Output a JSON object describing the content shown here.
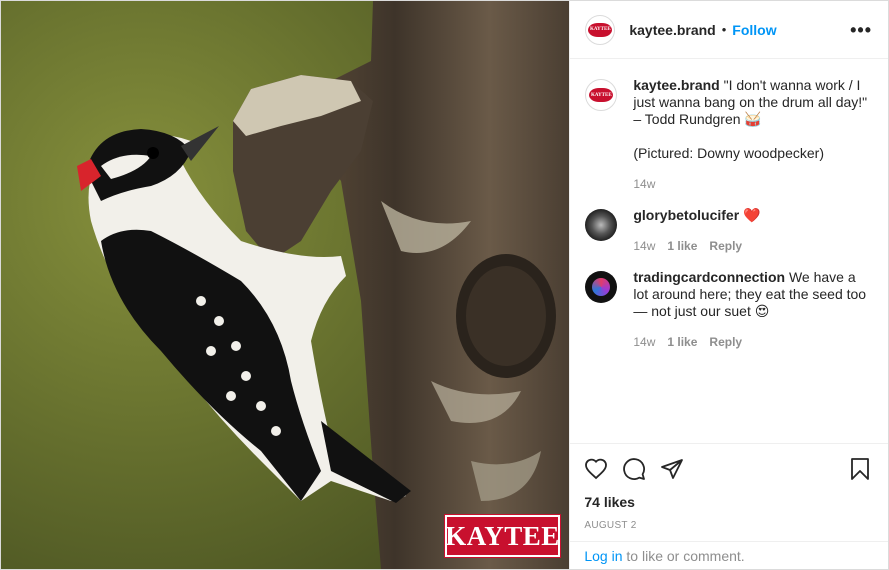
{
  "photo": {
    "brand_logo_text": "KAYTEE",
    "brand_color": "#c8102e"
  },
  "header": {
    "username": "kaytee.brand",
    "separator": "•",
    "follow_label": "Follow",
    "more_label": "•••",
    "avatar_text": "KAYTEE"
  },
  "caption": {
    "username": "kaytee.brand",
    "text": "\"I don't wanna work / I just wanna bang on the drum all day!\" – Todd Rundgren 🥁",
    "text2": "(Pictured: Downy woodpecker)",
    "time": "14w"
  },
  "comments": [
    {
      "username": "glorybetolucifer",
      "text": "❤️",
      "time": "14w",
      "likes": "1 like",
      "reply": "Reply"
    },
    {
      "username": "tradingcardconnection",
      "text": "We have a lot around here; they eat the seed too— not just our suet 😍",
      "time": "14w",
      "likes": "1 like",
      "reply": "Reply"
    }
  ],
  "actions": {
    "likes": "74 likes",
    "date": "AUGUST 2"
  },
  "login": {
    "link": "Log in",
    "rest": " to like or comment."
  },
  "colors": {
    "accent": "#0095f6",
    "muted": "#8e8e8e",
    "text": "#262626"
  }
}
